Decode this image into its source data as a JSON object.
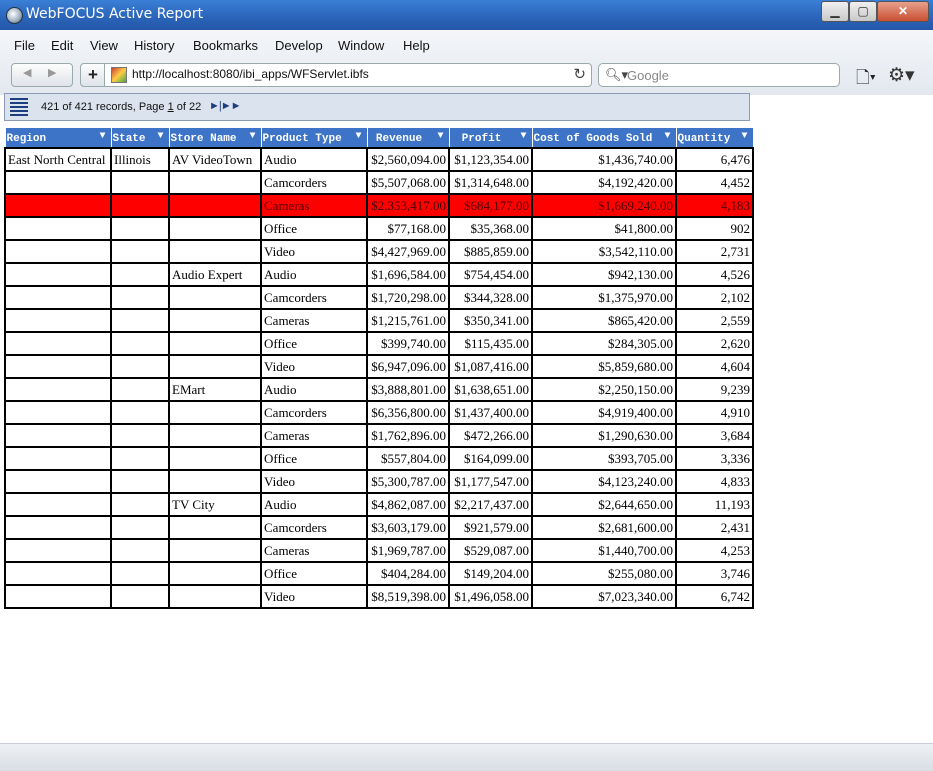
{
  "window": {
    "title": "WebFOCUS Active Report"
  },
  "menu": [
    "File",
    "Edit",
    "View",
    "History",
    "Bookmarks",
    "Develop",
    "Window",
    "Help"
  ],
  "address": {
    "url": "http://localhost:8080/ibi_apps/WFServlet.ibfs"
  },
  "search": {
    "placeholder": "Google"
  },
  "report": {
    "records_text": "421 of 421 records, Page ",
    "page_current": "1",
    "page_total_text": " of 22",
    "nav": "►|►►"
  },
  "table": {
    "columns": [
      "Region",
      "State",
      "Store Name",
      "Product Type",
      "Revenue",
      "Profit",
      "Cost of Goods Sold",
      "Quantity"
    ],
    "rows": [
      [
        "East North Central",
        "Illinois",
        "AV VideoTown",
        "Audio",
        "$2,560,094.00",
        "$1,123,354.00",
        "$1,436,740.00",
        "6,476"
      ],
      [
        "",
        "",
        "",
        "Camcorders",
        "$5,507,068.00",
        "$1,314,648.00",
        "$4,192,420.00",
        "4,452"
      ],
      [
        "",
        "",
        "",
        "Cameras",
        "$2,353,417.00",
        "$684,177.00",
        "$1,669,240.00",
        "4,183"
      ],
      [
        "",
        "",
        "",
        "Office",
        "$77,168.00",
        "$35,368.00",
        "$41,800.00",
        "902"
      ],
      [
        "",
        "",
        "",
        "Video",
        "$4,427,969.00",
        "$885,859.00",
        "$3,542,110.00",
        "2,731"
      ],
      [
        "",
        "",
        "Audio Expert",
        "Audio",
        "$1,696,584.00",
        "$754,454.00",
        "$942,130.00",
        "4,526"
      ],
      [
        "",
        "",
        "",
        "Camcorders",
        "$1,720,298.00",
        "$344,328.00",
        "$1,375,970.00",
        "2,102"
      ],
      [
        "",
        "",
        "",
        "Cameras",
        "$1,215,761.00",
        "$350,341.00",
        "$865,420.00",
        "2,559"
      ],
      [
        "",
        "",
        "",
        "Office",
        "$399,740.00",
        "$115,435.00",
        "$284,305.00",
        "2,620"
      ],
      [
        "",
        "",
        "",
        "Video",
        "$6,947,096.00",
        "$1,087,416.00",
        "$5,859,680.00",
        "4,604"
      ],
      [
        "",
        "",
        "EMart",
        "Audio",
        "$3,888,801.00",
        "$1,638,651.00",
        "$2,250,150.00",
        "9,239"
      ],
      [
        "",
        "",
        "",
        "Camcorders",
        "$6,356,800.00",
        "$1,437,400.00",
        "$4,919,400.00",
        "4,910"
      ],
      [
        "",
        "",
        "",
        "Cameras",
        "$1,762,896.00",
        "$472,266.00",
        "$1,290,630.00",
        "3,684"
      ],
      [
        "",
        "",
        "",
        "Office",
        "$557,804.00",
        "$164,099.00",
        "$393,705.00",
        "3,336"
      ],
      [
        "",
        "",
        "",
        "Video",
        "$5,300,787.00",
        "$1,177,547.00",
        "$4,123,240.00",
        "4,833"
      ],
      [
        "",
        "",
        "TV City",
        "Audio",
        "$4,862,087.00",
        "$2,217,437.00",
        "$2,644,650.00",
        "11,193"
      ],
      [
        "",
        "",
        "",
        "Camcorders",
        "$3,603,179.00",
        "$921,579.00",
        "$2,681,600.00",
        "2,431"
      ],
      [
        "",
        "",
        "",
        "Cameras",
        "$1,969,787.00",
        "$529,087.00",
        "$1,440,700.00",
        "4,253"
      ],
      [
        "",
        "",
        "",
        "Office",
        "$404,284.00",
        "$149,204.00",
        "$255,080.00",
        "3,746"
      ],
      [
        "",
        "",
        "",
        "Video",
        "$8,519,398.00",
        "$1,496,058.00",
        "$7,023,340.00",
        "6,742"
      ]
    ],
    "highlighted_row": 2,
    "colors": {
      "header_bg": "#3d74c8",
      "highlight": "#ff0000",
      "toolbar_bg": "#dbe3ee"
    }
  }
}
